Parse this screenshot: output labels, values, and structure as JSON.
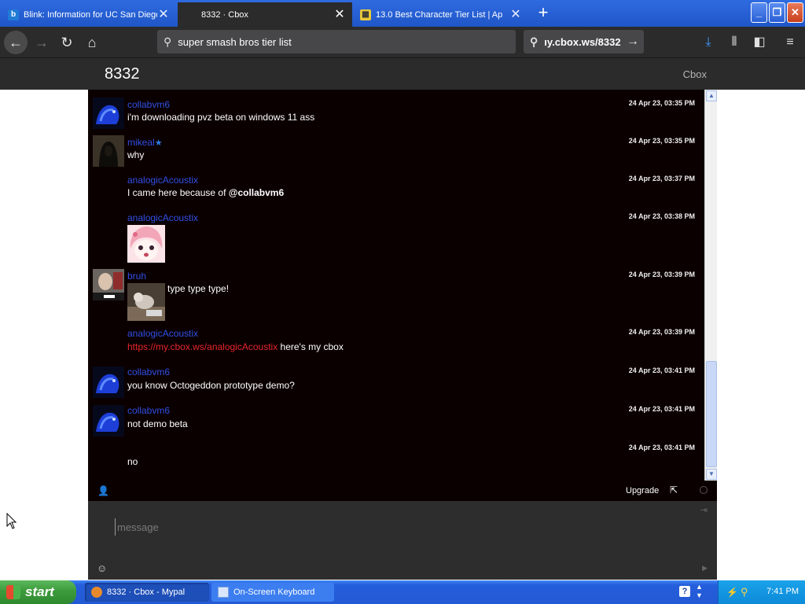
{
  "browser": {
    "tabs": [
      {
        "title": "Blink: Information for UC San Diego",
        "favicon": "b",
        "active": false
      },
      {
        "title": "8332 · Cbox",
        "favicon": "",
        "active": true
      },
      {
        "title": "13.0 Best Character Tier List | Ap",
        "favicon": "",
        "active": false
      }
    ],
    "search_text": "super smash bros tier list",
    "url_text": "ıy.cbox.ws/8332"
  },
  "page": {
    "title": "8332",
    "brand": "Cbox"
  },
  "messages": [
    {
      "user": "collabvm6",
      "time": "24 Apr 23, 03:35 PM",
      "text": "i'm downloading pvz beta on windows 11 ass",
      "avatar": "blue-creature-avatar"
    },
    {
      "user": "mikeal",
      "time": "24 Apr 23, 03:35 PM",
      "text": "why",
      "avatar": "dark-hooded-avatar",
      "verified": true
    },
    {
      "user": "analogicAcoustix",
      "time": "24 Apr 23, 03:37 PM",
      "text_prefix": "I came here because of ",
      "mention": "@collabvm6"
    },
    {
      "user": "analogicAcoustix",
      "time": "24 Apr 23, 03:38 PM",
      "image": "anime-girl-image"
    },
    {
      "user": "bruh",
      "time": "24 Apr 23, 03:39 PM",
      "text": "type type type!",
      "avatar": "bruh-avatar",
      "image": "cat-typing-image"
    },
    {
      "user": "analogicAcoustix",
      "time": "24 Apr 23, 03:39 PM",
      "link": "https://my.cbox.ws/analogicAcoustix",
      "text": " here's my cbox"
    },
    {
      "user": "collabvm6",
      "time": "24 Apr 23, 03:41 PM",
      "text": "you know Octogeddon prototype demo?",
      "avatar": "blue-creature-avatar"
    },
    {
      "user": "collabvm6",
      "time": "24 Apr 23, 03:41 PM",
      "text": "not demo beta",
      "avatar": "blue-creature-avatar"
    },
    {
      "user": "",
      "time": "24 Apr 23, 03:41 PM",
      "text": "no"
    }
  ],
  "chatbar": {
    "upgrade_label": "Upgrade"
  },
  "compose": {
    "placeholder": "message"
  },
  "taskbar": {
    "start_label": "start",
    "tasks": [
      {
        "label": "8332 · Cbox - Mypal",
        "active": true
      },
      {
        "label": "On-Screen Keyboard",
        "active": false
      }
    ],
    "clock": "7:41 PM"
  },
  "colors": {
    "chat_bg": "#0b0000",
    "username": "#2f4fe6",
    "link": "#e5252a",
    "header_bg": "#2b2b2b",
    "taskbar_blue": "#245edb",
    "start_green": "#3c9a3c"
  }
}
